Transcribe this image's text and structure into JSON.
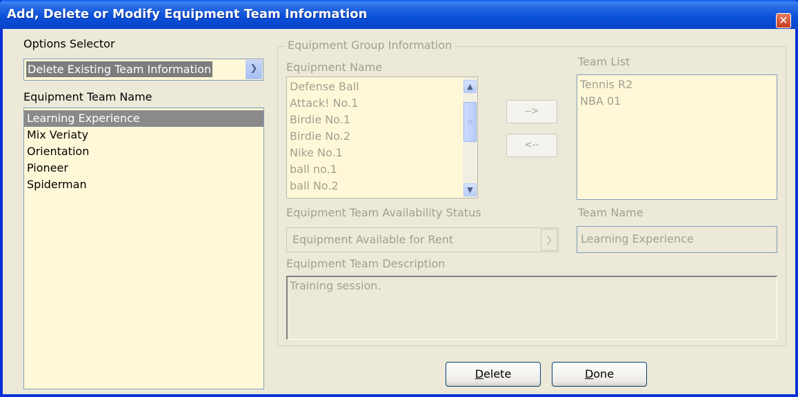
{
  "window": {
    "title": "Add, Delete or Modify Equipment Team Information",
    "close_glyph": "✕"
  },
  "options": {
    "label": "Options Selector",
    "selected": "Delete Existing Team Information",
    "arrow_icon": "chevron-down-icon"
  },
  "team_names": {
    "label": "Equipment Team Name",
    "items": [
      "Learning Experience",
      "Mix Veriaty",
      "Orientation",
      "Pioneer",
      "Spiderman"
    ],
    "selected_index": 0
  },
  "group": {
    "title": "Equipment Group Information",
    "equipment_name_label": "Equipment Name",
    "equipment_items": [
      "Defense Ball",
      "Attack! No.1",
      "Birdie No.1",
      "Birdie No.2",
      "Nike No.1",
      "ball no.1",
      "ball No.2"
    ],
    "add_button": "-->",
    "remove_button": "<--",
    "team_list_label": "Team List",
    "team_list_items": [
      "Tennis R2",
      "NBA 01"
    ],
    "status_label": "Equipment Team Availability Status",
    "status_value": "Equipment Available for Rent",
    "team_name_label": "Team Name",
    "team_name_value": "Learning Experience",
    "description_label": "Equipment Team Description",
    "description_value": "Training session."
  },
  "buttons": {
    "delete_mnemonic": "D",
    "delete_rest": "elete",
    "done_mnemonic": "D",
    "done_rest": "one"
  },
  "colors": {
    "title_bar": "#0a4fd8",
    "list_background": "#fff8d8",
    "selection": "#8a8a8a",
    "disabled_text": "#a0a090"
  }
}
